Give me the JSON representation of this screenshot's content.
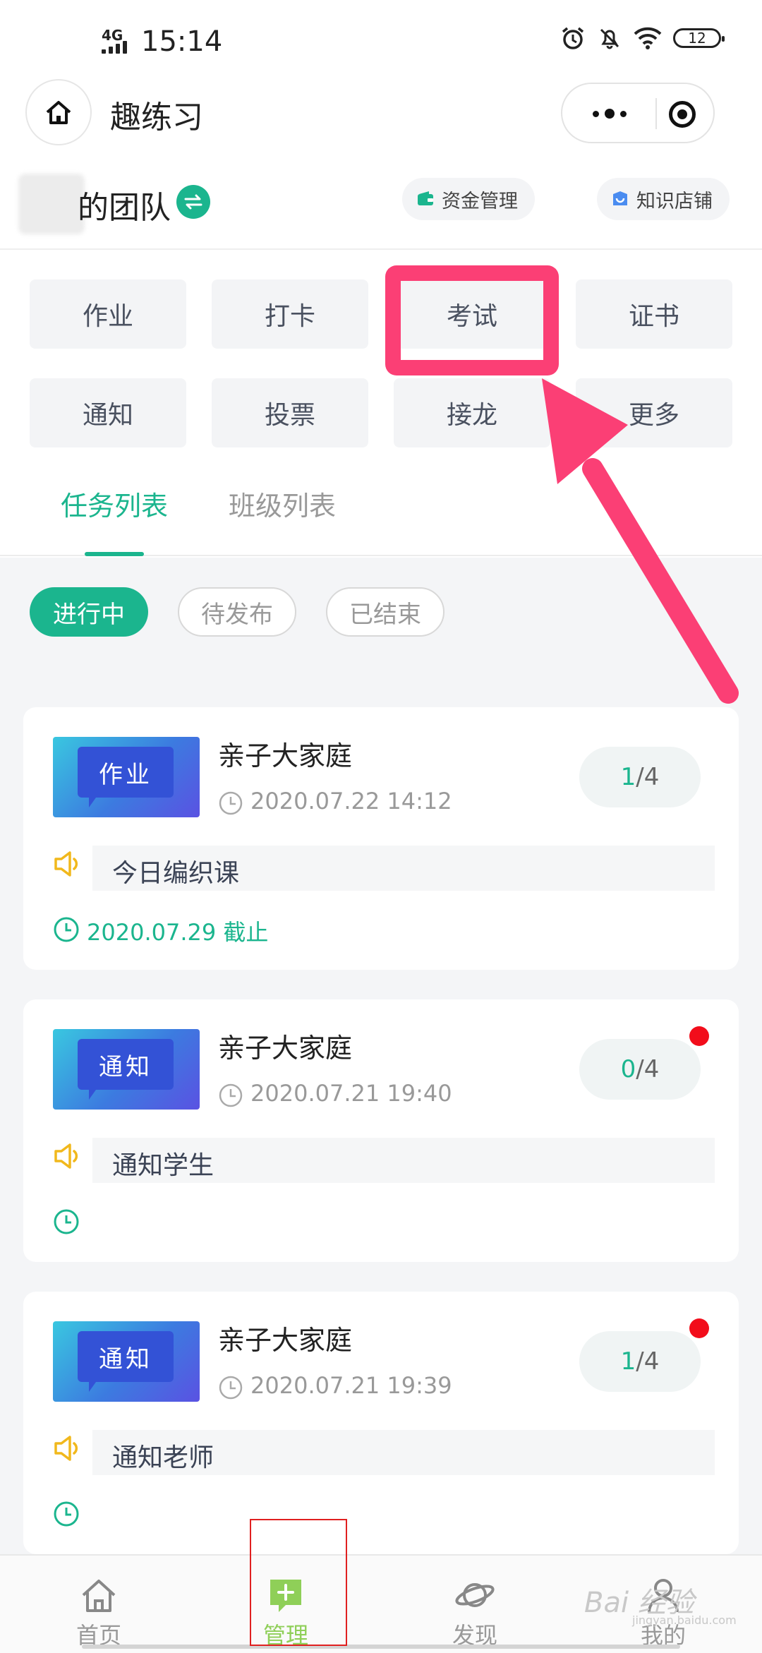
{
  "status_bar": {
    "network": "4G",
    "time": "15:14",
    "battery": "12"
  },
  "nav": {
    "title": "趣练习"
  },
  "team": {
    "name": "的团队",
    "actions": [
      {
        "label": "资金管理",
        "icon": "wallet-icon",
        "color": "#1bb58e"
      },
      {
        "label": "知识店铺",
        "icon": "shop-icon",
        "color": "#4a8cf0"
      }
    ]
  },
  "features": [
    {
      "label": "作业"
    },
    {
      "label": "打卡"
    },
    {
      "label": "考试"
    },
    {
      "label": "证书"
    },
    {
      "label": "通知"
    },
    {
      "label": "投票"
    },
    {
      "label": "接龙"
    },
    {
      "label": "更多"
    }
  ],
  "tabs": [
    {
      "label": "任务列表",
      "active": true
    },
    {
      "label": "班级列表",
      "active": false
    }
  ],
  "filters": [
    {
      "label": "进行中",
      "active": true
    },
    {
      "label": "待发布",
      "active": false
    },
    {
      "label": "已结束",
      "active": false
    }
  ],
  "tasks": [
    {
      "tag": "作业",
      "title": "亲子大家庭",
      "time": "2020.07.22 14:12",
      "done": "1",
      "total": "/4",
      "unread": false,
      "note": "今日编织课",
      "deadline": "2020.07.29 截止"
    },
    {
      "tag": "通知",
      "title": "亲子大家庭",
      "time": "2020.07.21 19:40",
      "done": "0",
      "total": "/4",
      "unread": true,
      "note": "通知学生",
      "deadline": ""
    },
    {
      "tag": "通知",
      "title": "亲子大家庭",
      "time": "2020.07.21 19:39",
      "done": "1",
      "total": "/4",
      "unread": true,
      "note": "通知老师",
      "deadline": ""
    }
  ],
  "bottom_nav": [
    {
      "label": "首页",
      "icon": "home-icon",
      "active": false
    },
    {
      "label": "管理",
      "icon": "plus-chat-icon",
      "active": true
    },
    {
      "label": "发现",
      "icon": "planet-icon",
      "active": false
    },
    {
      "label": "我的",
      "icon": "user-icon",
      "active": false
    }
  ],
  "watermark": {
    "text": "Bai 经验",
    "sub": "jingyan.baidu.com"
  },
  "colors": {
    "accent": "#1bb58e",
    "annotation": "#fb3f75",
    "nav_active": "#8fcf58",
    "unread": "#f20d1b"
  }
}
